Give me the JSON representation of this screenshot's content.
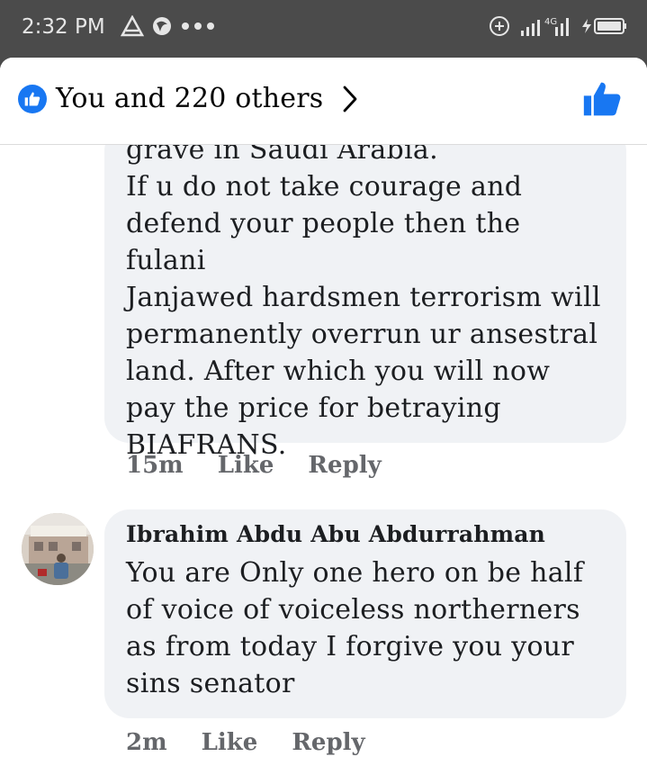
{
  "status_bar": {
    "time": "2:32 PM",
    "left_icons": [
      "navigation-icon",
      "notification-app-icon",
      "more-dots-icon"
    ],
    "right_icons": [
      "data-saver-icon",
      "signal-4g-icon",
      "battery-charging-icon"
    ],
    "network_label": "4G"
  },
  "header": {
    "reactions_label": "You and 220 others",
    "like_badge_icon": "thumbs-up-icon",
    "accent_color": "#1877f2"
  },
  "comments": [
    {
      "author": "",
      "text": "grave in Saudi Arabia.\nIf u do not take courage and\ndefend your people then the fulani\nJanjawed hardsmen terrorism will\npermanently overrun ur ansestral\nland. After which you will now\npay the price for betraying\nBIAFRANS.",
      "time": "15m",
      "like_label": "Like",
      "reply_label": "Reply"
    },
    {
      "author": "Ibrahim Abdu Abu Abdurrahman",
      "text": "You are Only one hero on be half\nof voice of voiceless northerners\nas from today I forgive you your\nsins senator",
      "time": "2m",
      "like_label": "Like",
      "reply_label": "Reply"
    }
  ]
}
